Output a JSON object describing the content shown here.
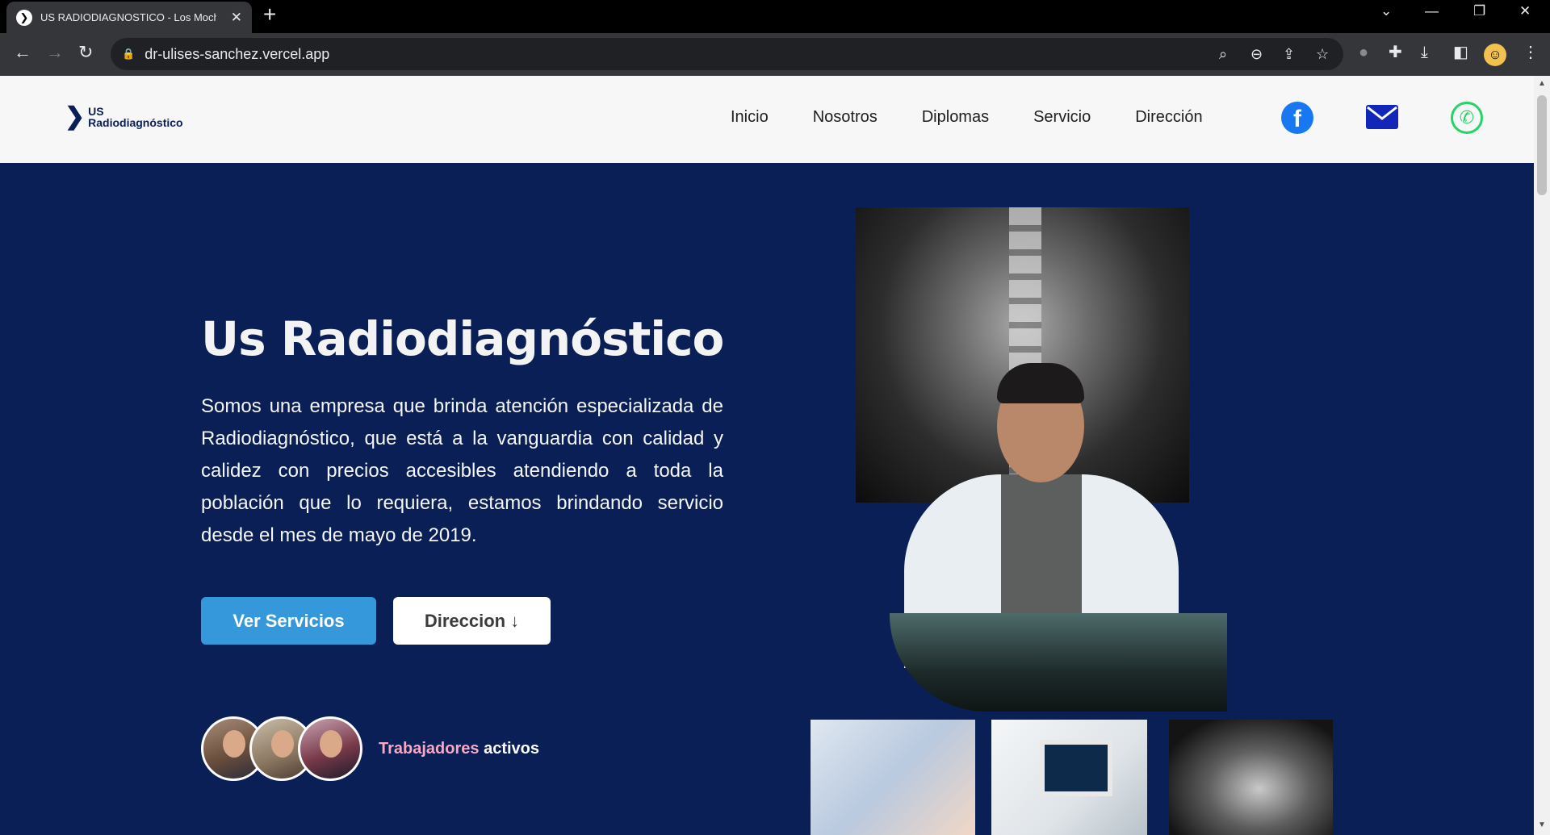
{
  "browser": {
    "tab_title": "US RADIODIAGNOSTICO - Los Mochis,",
    "tab_favicon": "site-favicon",
    "url": "dr-ulises-sanchez.vercel.app"
  },
  "header": {
    "logo_us": "US",
    "logo_name": "Radiodiagnóstico",
    "nav": [
      "Inicio",
      "Nosotros",
      "Diplomas",
      "Servicio",
      "Dirección"
    ],
    "social": {
      "facebook_glyph": "f",
      "whatsapp_glyph": "✆"
    },
    "colors": {
      "facebook": "#1877f2",
      "mail": "#1227b8",
      "whatsapp": "#25d366"
    }
  },
  "hero": {
    "title": "Us Radiodiagnóstico",
    "description": "Somos una empresa que brinda atención especializada de Radiodiagnóstico, que está a la vanguardia con calidad y calidez con precios accesibles atendiendo a toda la población que lo requiera, estamos brindando servicio desde el mes de mayo de 2019.",
    "primary_button": "Ver Servicios",
    "secondary_button": "Direccion ↓",
    "workers_accent": "Trabajadores",
    "workers_rest": " activos",
    "colors": {
      "background": "#0a1f55",
      "primary_button": "#3598db",
      "accent": "#f7a8c4"
    }
  }
}
